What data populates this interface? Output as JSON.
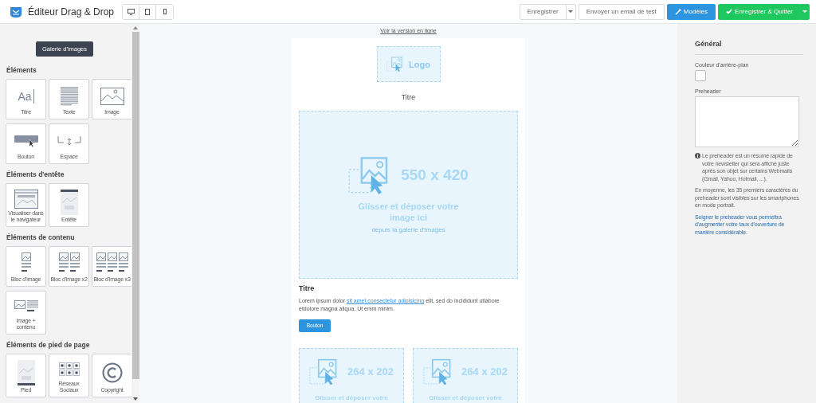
{
  "header": {
    "title": "Éditeur Drag & Drop",
    "devices": [
      {
        "kind": "desktop"
      },
      {
        "kind": "tablet"
      },
      {
        "kind": "phone"
      }
    ],
    "actions": [
      {
        "kind": "split",
        "label": "Enregistrer"
      },
      {
        "kind": "plain",
        "label": "Envoyer un email de test"
      },
      {
        "kind": "templates",
        "label": "Modèles"
      },
      {
        "kind": "save-quit",
        "label": "Enregistrer & Quitter"
      }
    ]
  },
  "sidebar": {
    "gallery_button": "Galerie d'images",
    "sections": [
      {
        "title": "Éléments",
        "tiles": [
          {
            "kind": "title",
            "label": "Titre",
            "glyph": "Aa"
          },
          {
            "kind": "text",
            "label": "Texte"
          },
          {
            "kind": "image",
            "label": "Image"
          },
          {
            "kind": "button",
            "label": "Bouton"
          },
          {
            "kind": "space",
            "label": "Espace"
          }
        ]
      },
      {
        "title": "Éléments d'entête",
        "tiles": [
          {
            "kind": "browser",
            "label": "Visualiser dans le navigateur"
          },
          {
            "kind": "header",
            "label": "Entête"
          }
        ]
      },
      {
        "title": "Éléments de contenu",
        "tiles": [
          {
            "kind": "block1",
            "label": "Bloc d'image"
          },
          {
            "kind": "block2",
            "label": "Bloc d'image x2"
          },
          {
            "kind": "block3",
            "label": "Bloc d'image x3"
          },
          {
            "kind": "imgtext",
            "label": "Image + contenu"
          }
        ]
      },
      {
        "title": "Éléments de pied de page",
        "tiles": [
          {
            "kind": "footer",
            "label": "Pied"
          },
          {
            "kind": "social",
            "label": "Réseaux Sociaux"
          },
          {
            "kind": "copyright",
            "label": "Copyright"
          }
        ]
      }
    ]
  },
  "email": {
    "online_link": "Voir la version en ligne",
    "logo": "Logo",
    "heading": "Titre",
    "hero": {
      "size": "550 x 420",
      "drop_text": "Glisser et déposer votre image ici",
      "hint": "depuis la galerie d'images"
    },
    "article": {
      "title": "Titre",
      "text_before": "Lorem ipsum dolor ",
      "link": "sit amet,consectetur adipisicing",
      "text_after": " elit, sed do incididunt utlabore etdolore magna aliqua. Ut enim minim.",
      "button": "Bouton"
    },
    "columns": [
      {
        "size": "264 x 202",
        "drop_text": "Glisser et déposer votre"
      },
      {
        "size": "264 x 202",
        "drop_text": "Glisser et déposer votre"
      }
    ]
  },
  "settings": {
    "title": "Général",
    "bg_label": "Couleur d'arrière-plan",
    "preheader_label": "Preheader",
    "info": "Le preheader est un résumé rapide de votre newsletter qui sera affiché juste après son objet sur certains Webmails (Gmail, Yahoo, Hotmail, ...).",
    "note": "En moyenne, les 35 premiers caractères du preheader sont visibles sur les smartphones en mode portrait.",
    "tip": "Soigner le preheader vous permettra d'augmenter votre taux d'ouverture de manière considérable."
  }
}
